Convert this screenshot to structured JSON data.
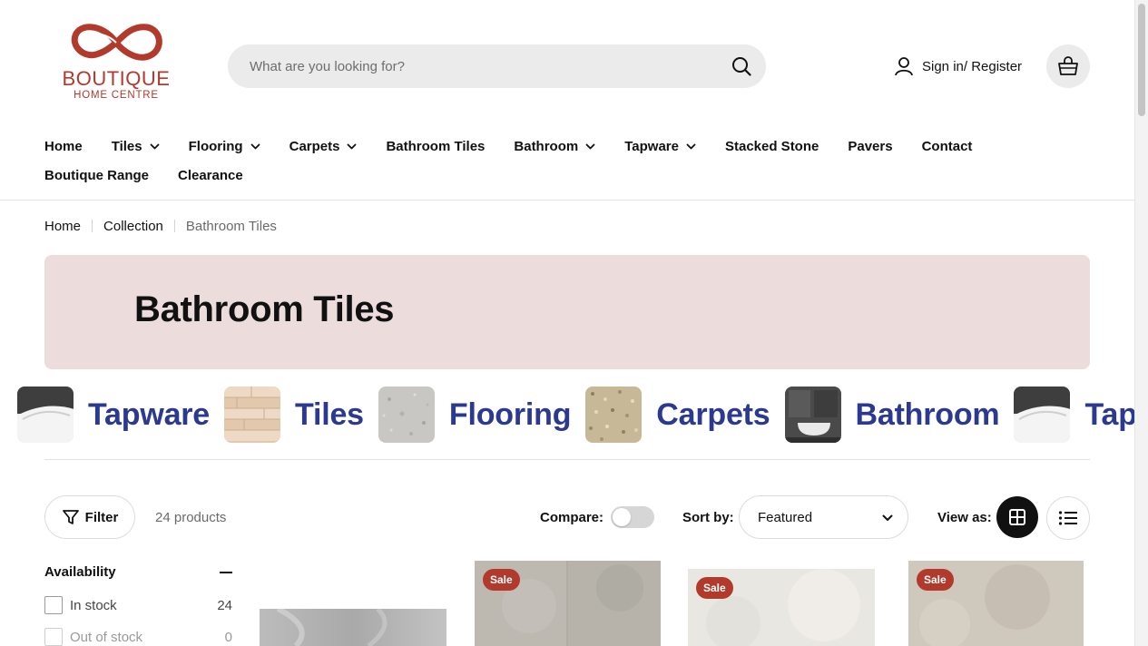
{
  "header": {
    "logo_brand": "BOUTIQUE",
    "logo_sub": "HOME CENTRE",
    "search_placeholder": "What are you looking for?",
    "signin_label": "Sign in/ Register"
  },
  "nav": {
    "row1": [
      {
        "label": "Home",
        "dropdown": false
      },
      {
        "label": "Tiles",
        "dropdown": true
      },
      {
        "label": "Flooring",
        "dropdown": true
      },
      {
        "label": "Carpets",
        "dropdown": true
      },
      {
        "label": "Bathroom Tiles",
        "dropdown": false
      },
      {
        "label": "Bathroom",
        "dropdown": true
      },
      {
        "label": "Tapware",
        "dropdown": true
      },
      {
        "label": "Stacked Stone",
        "dropdown": false
      },
      {
        "label": "Pavers",
        "dropdown": false
      },
      {
        "label": "Contact",
        "dropdown": false
      }
    ],
    "row2": [
      {
        "label": "Boutique Range",
        "dropdown": false
      },
      {
        "label": "Clearance",
        "dropdown": false
      }
    ]
  },
  "breadcrumb": {
    "home": "Home",
    "collection": "Collection",
    "current": "Bathroom Tiles"
  },
  "banner": {
    "title": "Bathroom Tiles"
  },
  "categories": [
    {
      "label": "Tapware"
    },
    {
      "label": "Tiles"
    },
    {
      "label": "Flooring"
    },
    {
      "label": "Carpets"
    },
    {
      "label": "Bathroom"
    },
    {
      "label": "Tapware"
    }
  ],
  "toolbar": {
    "filter_label": "Filter",
    "product_count": "24 products",
    "compare_label": "Compare:",
    "sort_label": "Sort by:",
    "sort_value": "Featured",
    "view_label": "View as:"
  },
  "filters": {
    "availability_title": "Availability",
    "options": [
      {
        "label": "In stock",
        "count": "24"
      },
      {
        "label": "Out of stock",
        "count": "0"
      }
    ]
  },
  "products": [
    {
      "badge": ""
    },
    {
      "badge": "Sale"
    },
    {
      "badge": "Sale"
    },
    {
      "badge": "Sale"
    }
  ],
  "colors": {
    "brand_red": "#b23a2c",
    "category_blue": "#2b3990",
    "banner_bg": "#eddcdc"
  }
}
